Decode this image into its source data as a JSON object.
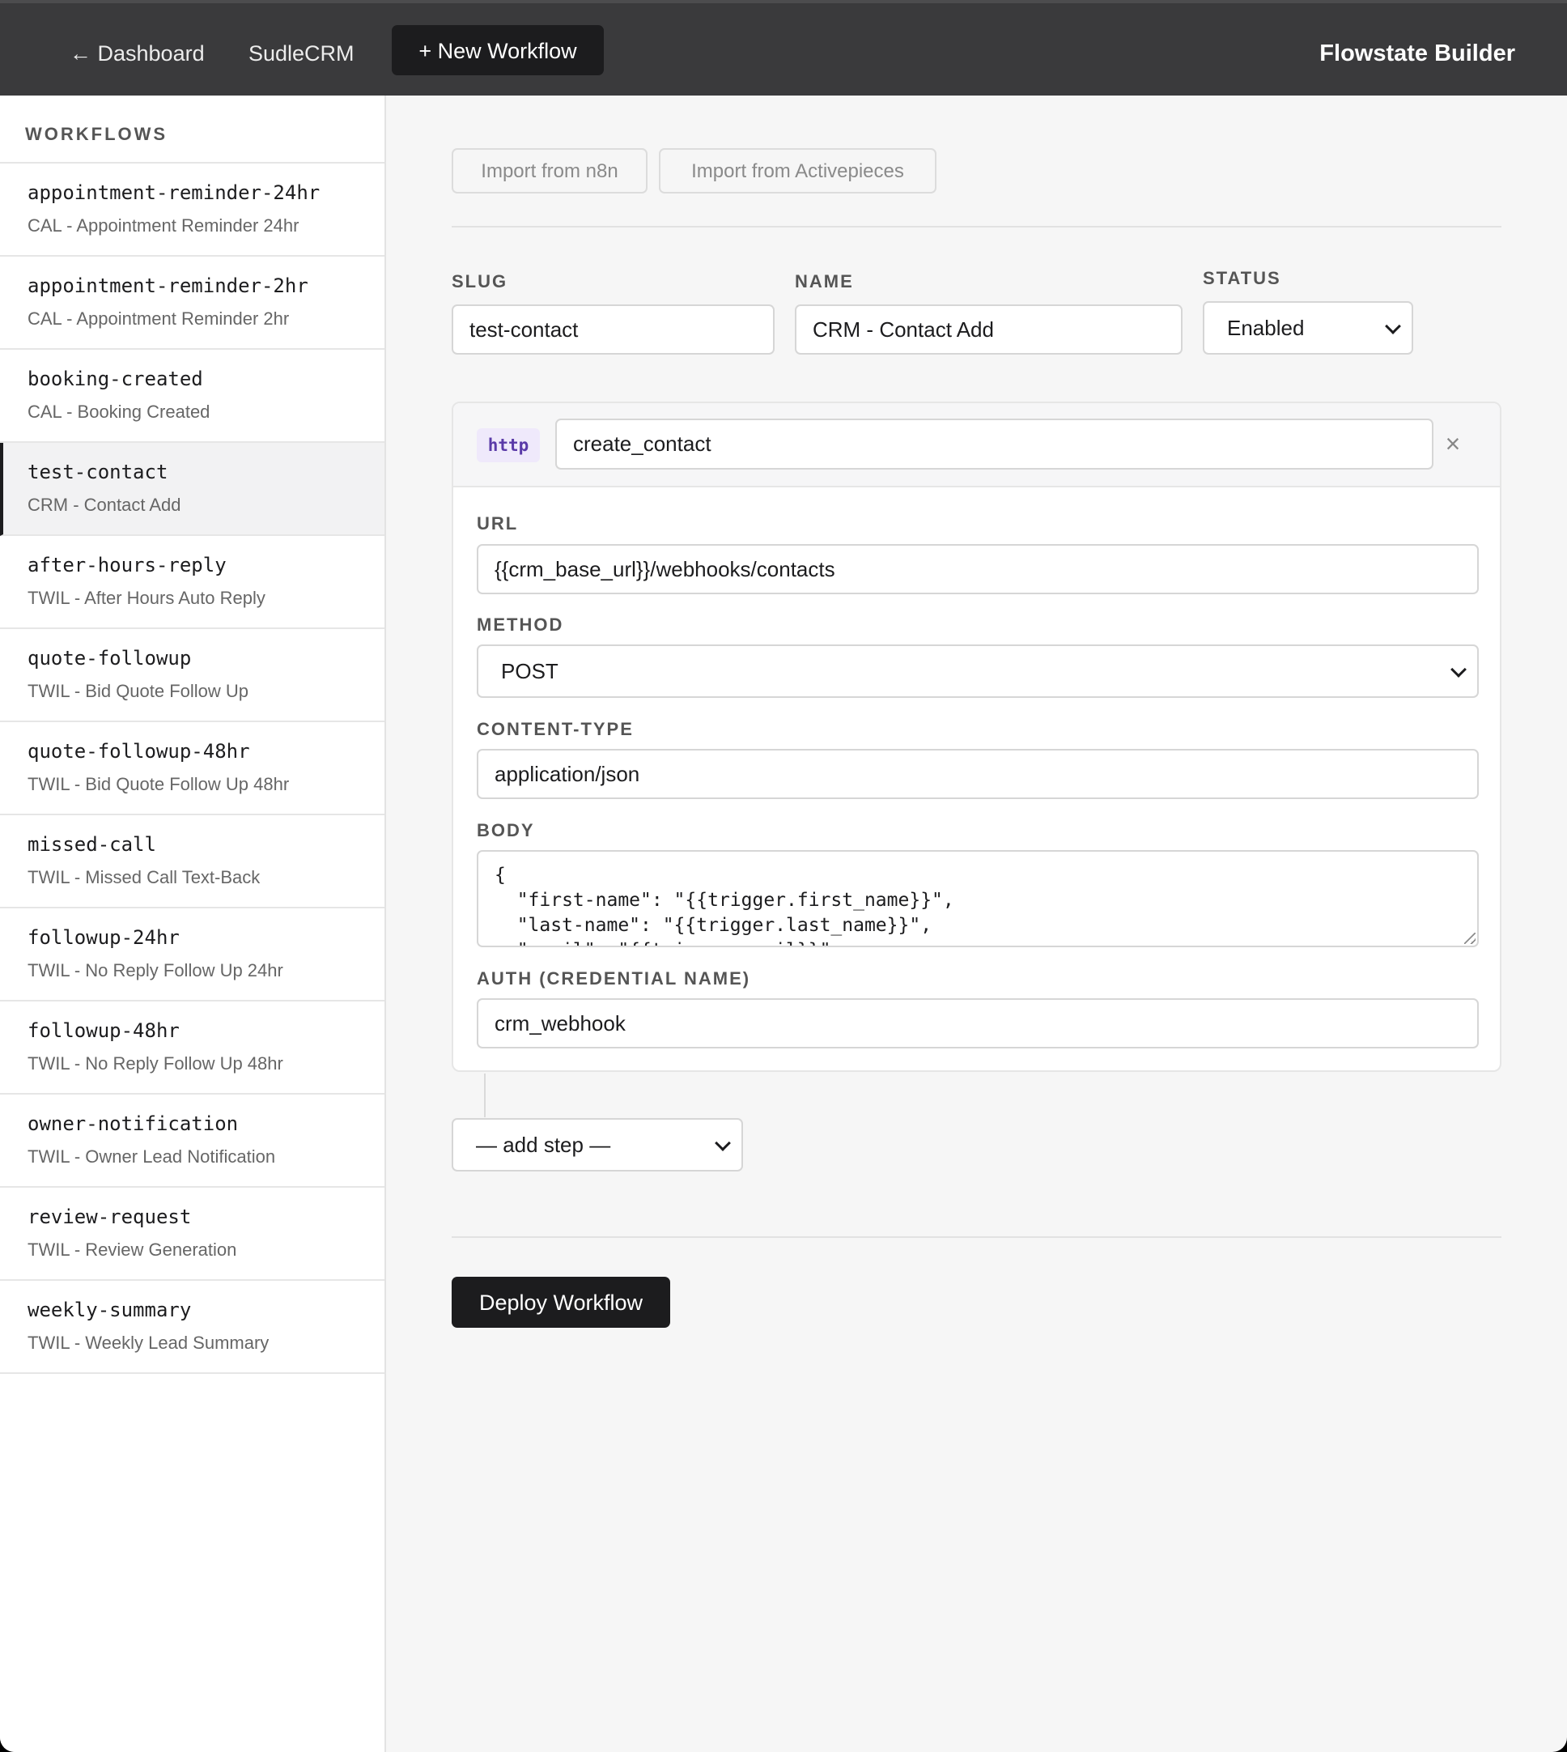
{
  "topbar": {
    "back_label": "← Dashboard",
    "crm_label": "SudleCRM",
    "new_workflow_label": "+ New Workflow",
    "brand": "Flowstate Builder"
  },
  "sidebar": {
    "heading": "WORKFLOWS",
    "items": [
      {
        "slug": "appointment-reminder-24hr",
        "name": "CAL - Appointment Reminder 24hr"
      },
      {
        "slug": "appointment-reminder-2hr",
        "name": "CAL - Appointment Reminder 2hr"
      },
      {
        "slug": "booking-created",
        "name": "CAL - Booking Created"
      },
      {
        "slug": "test-contact",
        "name": "CRM - Contact Add"
      },
      {
        "slug": "after-hours-reply",
        "name": "TWIL - After Hours Auto Reply"
      },
      {
        "slug": "quote-followup",
        "name": "TWIL - Bid Quote Follow Up"
      },
      {
        "slug": "quote-followup-48hr",
        "name": "TWIL - Bid Quote Follow Up 48hr"
      },
      {
        "slug": "missed-call",
        "name": "TWIL - Missed Call Text-Back"
      },
      {
        "slug": "followup-24hr",
        "name": "TWIL - No Reply Follow Up 24hr"
      },
      {
        "slug": "followup-48hr",
        "name": "TWIL - No Reply Follow Up 48hr"
      },
      {
        "slug": "owner-notification",
        "name": "TWIL - Owner Lead Notification"
      },
      {
        "slug": "review-request",
        "name": "TWIL - Review Generation"
      },
      {
        "slug": "weekly-summary",
        "name": "TWIL - Weekly Lead Summary"
      }
    ]
  },
  "main": {
    "import_n8n": "Import from n8n",
    "import_activepieces": "Import from Activepieces",
    "slug_label": "SLUG",
    "slug_value": "test-contact",
    "name_label": "NAME",
    "name_value": "CRM - Contact Add",
    "status_label": "STATUS",
    "status_value": "Enabled",
    "step": {
      "type": "http",
      "step_name": "create_contact",
      "remove_symbol": "×",
      "url_label": "URL",
      "url_value": "{{crm_base_url}}/webhooks/contacts",
      "method_label": "METHOD",
      "method_value": "POST",
      "content_type_label": "CONTENT-TYPE",
      "content_type_value": "application/json",
      "body_label": "BODY",
      "body_value": "{\n  \"first-name\": \"{{trigger.first_name}}\",\n  \"last-name\": \"{{trigger.last_name}}\",\n  \"email\": \"{{trigger.email}}\"",
      "auth_label": "AUTH (CREDENTIAL NAME)",
      "auth_value": "crm_webhook"
    },
    "add_step_label": "— add step —",
    "deploy_label": "Deploy Workflow"
  }
}
